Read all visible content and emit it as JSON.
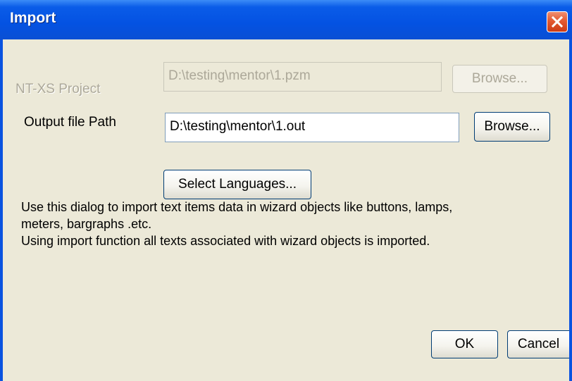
{
  "window": {
    "title": "Import",
    "close_icon": "close-icon",
    "accent_color": "#0a53e0",
    "close_color": "#e35a32"
  },
  "form": {
    "project": {
      "label": "NT-XS Project",
      "value": "D:\\testing\\mentor\\1.pzm",
      "browse_label": "Browse...",
      "enabled": false
    },
    "output": {
      "label": "Output file Path",
      "value": "D:\\testing\\mentor\\1.out",
      "browse_label": "Browse...",
      "enabled": true
    },
    "select_languages_label": "Select Languages..."
  },
  "description": {
    "lines": [
      "Use this dialog to import text items data in wizard objects like buttons, lamps,",
      "meters, bargraphs .etc.",
      "Using import function all texts associated with wizard objects is imported."
    ]
  },
  "footer": {
    "ok_label": "OK",
    "cancel_label": "Cancel"
  }
}
